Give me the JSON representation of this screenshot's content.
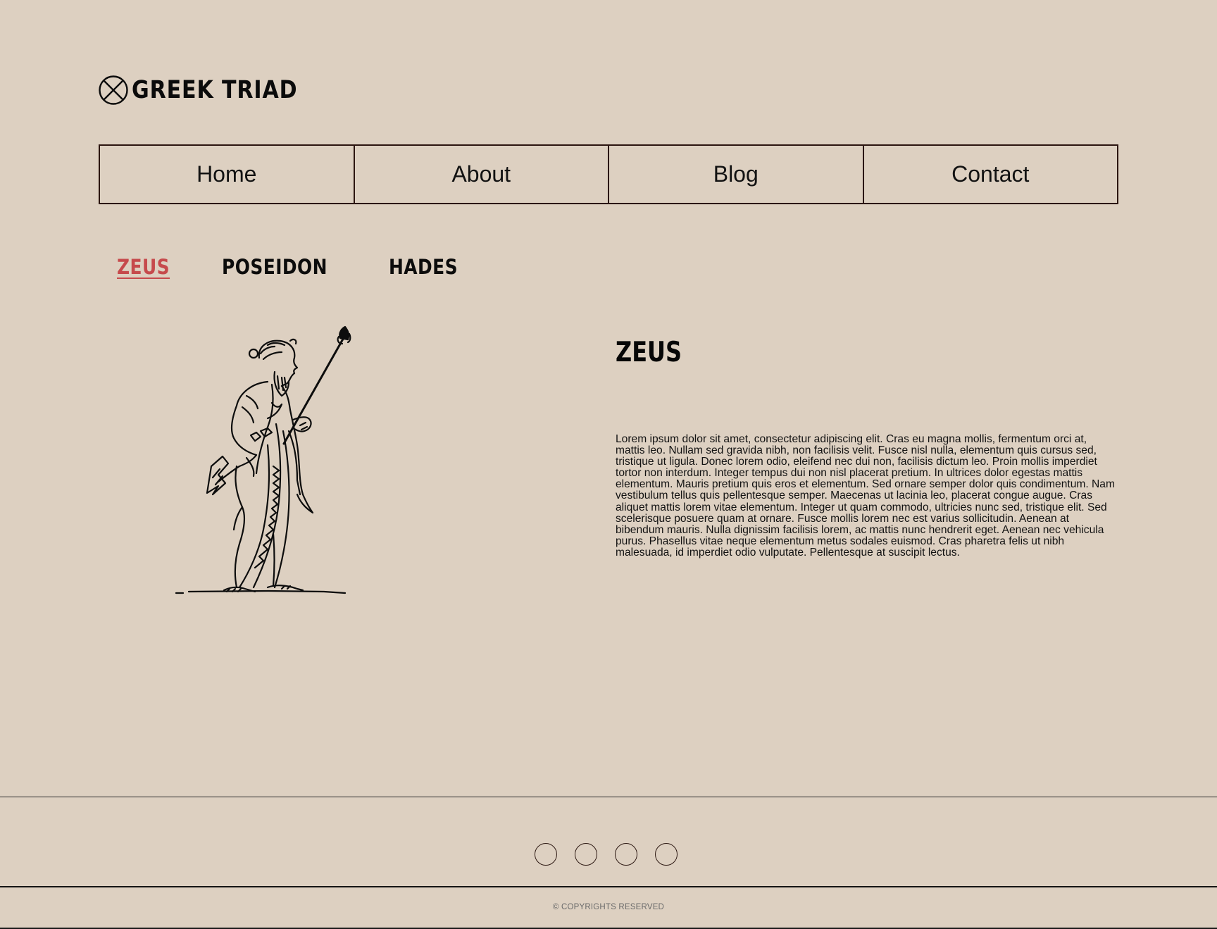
{
  "site": {
    "logo_text": "GREEK TRIAD",
    "logo_icon": "crossed-circle-icon"
  },
  "nav": {
    "items": [
      {
        "label": "Home"
      },
      {
        "label": "About"
      },
      {
        "label": "Blog"
      },
      {
        "label": "Contact"
      }
    ]
  },
  "god_tabs": {
    "items": [
      {
        "label": "ZEUS",
        "active": true
      },
      {
        "label": "POSEIDON",
        "active": false
      },
      {
        "label": "HADES",
        "active": false
      }
    ],
    "active_color": "#c64a4c"
  },
  "content": {
    "image": "zeus-illustration",
    "title": "ZEUS",
    "body": "Lorem ipsum dolor sit amet, consectetur adipiscing elit. Cras eu magna mollis, fermentum orci at, mattis leo. Nullam sed gravida nibh, non facilisis velit. Fusce nisl nulla, elementum quis cursus sed, tristique ut ligula. Donec lorem odio, eleifend nec dui non, facilisis dictum leo. Proin mollis imperdiet tortor non interdum. Integer tempus dui non nisl placerat pretium. In ultrices dolor egestas mattis elementum. Mauris pretium quis eros et elementum. Sed ornare semper dolor quis condimentum. Nam vestibulum tellus quis pellentesque semper. Maecenas ut lacinia leo, placerat congue augue. Cras aliquet mattis lorem vitae elementum. Integer ut quam commodo, ultricies nunc sed, tristique elit. Sed scelerisque posuere quam at ornare. Fusce mollis lorem nec est varius sollicitudin. Aenean at bibendum mauris. Nulla dignissim facilisis lorem, ac mattis nunc hendrerit eget. Aenean nec vehicula purus. Phasellus vitae neque elementum metus sodales euismod. Cras pharetra felis ut nibh malesuada, id imperdiet odio vulputate. Pellentesque at suscipit lectus."
  },
  "footer": {
    "social_icons": [
      "social-icon-1",
      "social-icon-2",
      "social-icon-3",
      "social-icon-4"
    ],
    "copyright": "© COPYRIGHTS RESERVED"
  },
  "colors": {
    "background": "#ddd0c1",
    "border": "#2b1510",
    "accent": "#c64a4c"
  }
}
